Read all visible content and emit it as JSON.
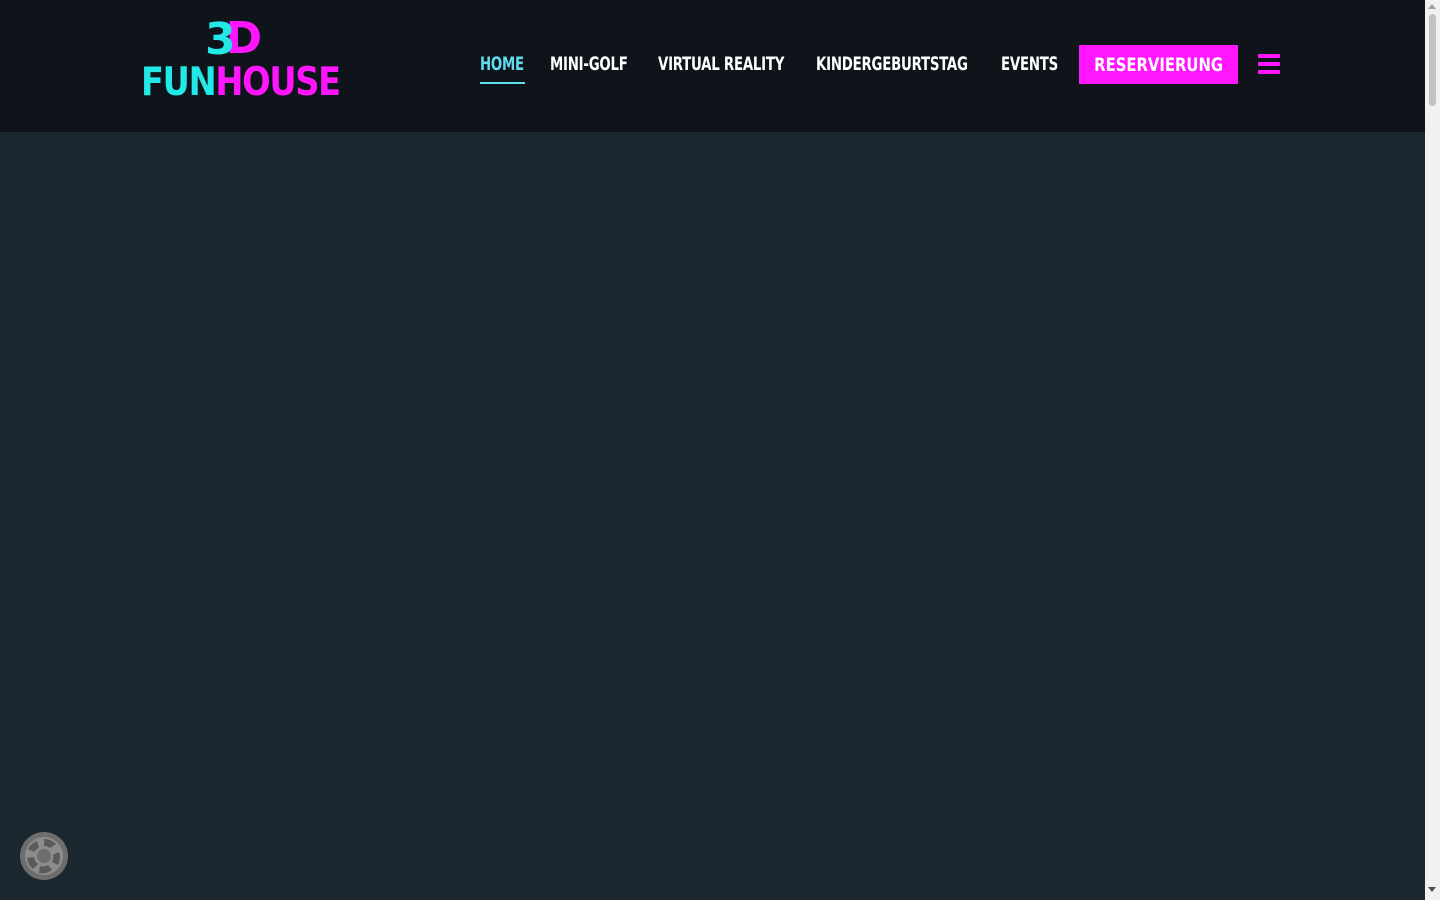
{
  "logo": {
    "top_3": "3",
    "top_d": "D",
    "word_fun": "FUN",
    "word_house": "HOUSE"
  },
  "nav": {
    "items": [
      {
        "label": "HOME",
        "active": true
      },
      {
        "label": "MINI-GOLF",
        "active": false
      },
      {
        "label": "VIRTUAL REALITY",
        "active": false
      },
      {
        "label": "KINDERGEBURTSTAG",
        "active": false
      },
      {
        "label": "EVENTS",
        "active": false
      }
    ],
    "cta_label": "RESERVIERUNG",
    "menu_icon": "hamburger-menu-icon"
  },
  "widget": {
    "icon": "privacy-settings-icon"
  },
  "colors": {
    "header_bg": "#0e1419",
    "page_bg": "#1c2830",
    "accent_cyan": "#5fdcee",
    "accent_magenta": "#ff16ff",
    "logo_cyan": "#22e8e8"
  }
}
